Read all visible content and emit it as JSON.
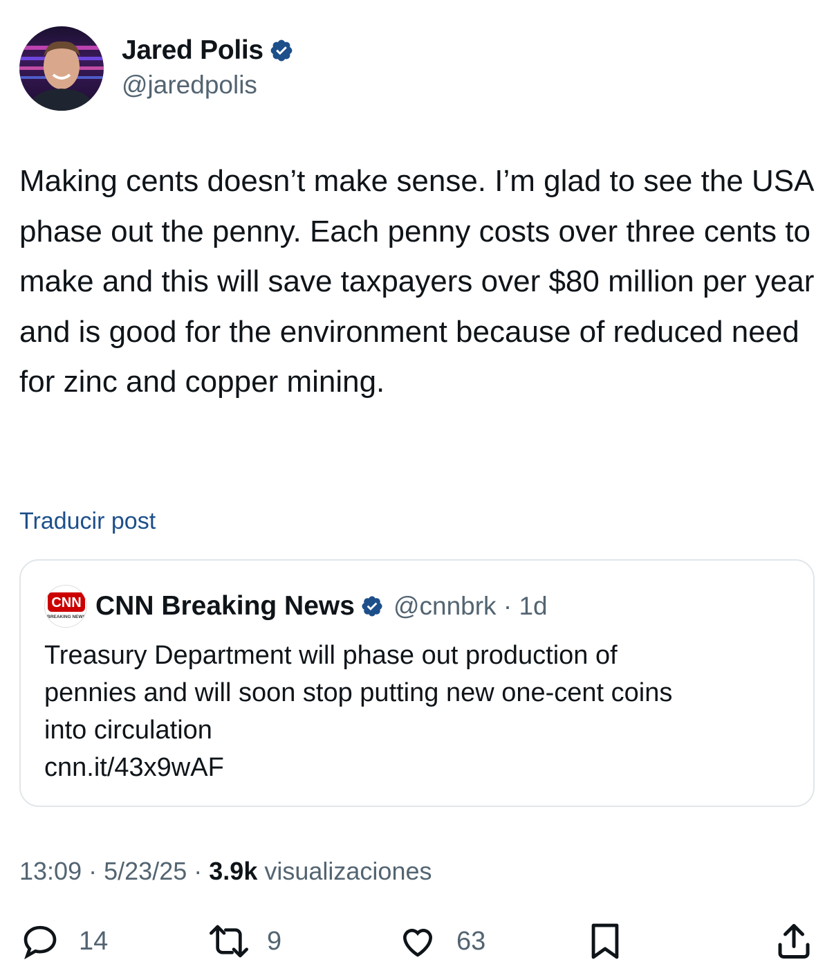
{
  "author": {
    "name": "Jared Polis",
    "handle": "@jaredpolis"
  },
  "post": {
    "text": "Making cents doesn’t make sense. I’m glad to see the USA phase out the penny. Each penny costs over three cents to make and this will save taxpayers over $80 million per year and is good for the environment because of reduced need for zinc and copper mining.",
    "translate_label": "Traducir post"
  },
  "quote": {
    "name": "CNN Breaking News",
    "handle": "@cnnbrk",
    "separator": "·",
    "age": "1d",
    "logo_text": "CNN",
    "logo_sub": "BREAKING NEWS",
    "text_lines": [
      "Treasury Department will phase out production of",
      "pennies and will soon stop putting new one-cent coins",
      "into circulation",
      "cnn.it/43x9wAF"
    ]
  },
  "meta": {
    "time": "13:09",
    "date": "5/23/25",
    "sep": "·",
    "views_count": "3.9k",
    "views_label": "visualizaciones"
  },
  "actions": {
    "replies": "14",
    "reposts": "9",
    "likes": "63"
  },
  "colors": {
    "verified": "#1d4f8a",
    "link": "#1d4f8a",
    "secondary_text": "#536471",
    "cnn_red": "#cc0000"
  }
}
